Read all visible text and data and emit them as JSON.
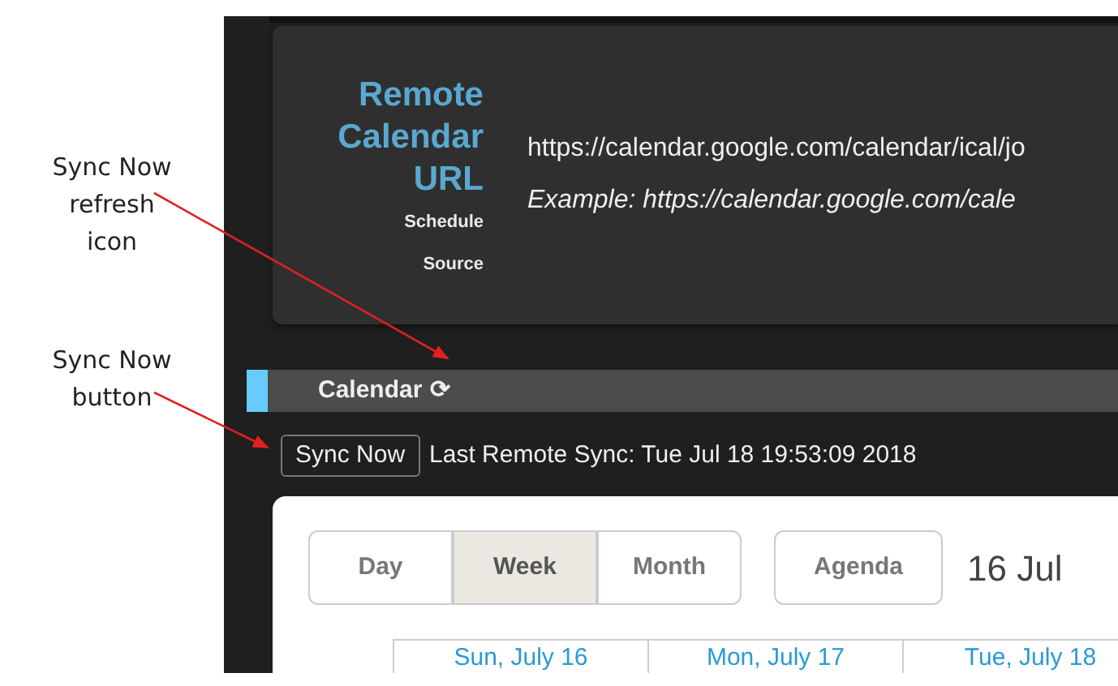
{
  "annotations": [
    {
      "text": "Sync Now refresh icon"
    },
    {
      "text": "Sync Now button"
    }
  ],
  "settings_card": {
    "label": "Remote Calendar URL",
    "sublabel": [
      "Schedule",
      "Source"
    ],
    "value": "https://calendar.google.com/calendar/ical/jo",
    "hint": "Example: https://calendar.google.com/cale"
  },
  "section_header": {
    "title": "Calendar",
    "icon": "⟳"
  },
  "sync": {
    "button": "Sync Now",
    "status": "Last Remote Sync: Tue Jul 18 19:53:09 2018"
  },
  "calendar": {
    "views": [
      {
        "label": "Day",
        "selected": false
      },
      {
        "label": "Week",
        "selected": true
      },
      {
        "label": "Month",
        "selected": false
      }
    ],
    "agenda": {
      "label": "Agenda",
      "selected": false
    },
    "date_title": "16 Jul",
    "day_headers": [
      "Sun, July 16",
      "Mon, July 17",
      "Tue, July 18"
    ]
  }
}
